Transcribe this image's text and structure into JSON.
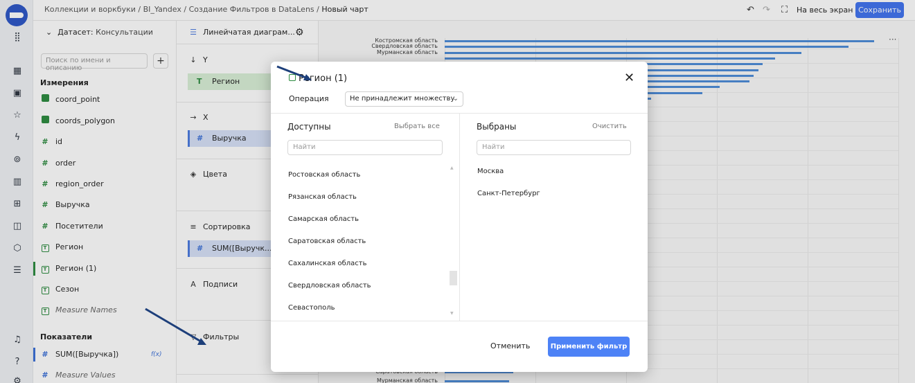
{
  "breadcrumbs": {
    "items": [
      "Коллекции и воркбуки",
      "BI_Yandex",
      "Создание Фильтров в DataLens"
    ],
    "sep": " / ",
    "current": "Новый чарт"
  },
  "header": {
    "fullscreen_label": "На весь экран",
    "save_label": "Сохранить"
  },
  "dataset": {
    "label": "Датасет:",
    "value": "Консультации",
    "search_placeholder": "Поиск по имени и описанию",
    "dimensions_title": "Измерения",
    "dimensions": [
      {
        "name": "coord_point",
        "type": "geo"
      },
      {
        "name": "coords_polygon",
        "type": "geo"
      },
      {
        "name": "id",
        "type": "num"
      },
      {
        "name": "order",
        "type": "num"
      },
      {
        "name": "region_order",
        "type": "num"
      },
      {
        "name": "Выручка",
        "type": "num"
      },
      {
        "name": "Посетители",
        "type": "num"
      },
      {
        "name": "Регион",
        "type": "text"
      },
      {
        "name": "Регион (1)",
        "type": "text"
      },
      {
        "name": "Сезон",
        "type": "text"
      },
      {
        "name": "Measure Names",
        "type": "text"
      }
    ],
    "measures_title": "Показатели",
    "measures": [
      {
        "name": "SUM([Выручка])",
        "badge": "f(x)"
      },
      {
        "name": "Measure Values"
      }
    ]
  },
  "shelves": {
    "chart_type": "Линейчатая диаграм...",
    "y_label": "Y",
    "y_chip": "Регион",
    "x_label": "X",
    "x_chip": "Выручка",
    "colors_label": "Цвета",
    "sort_label": "Сортировка",
    "sort_chip": "SUM([Выручк...",
    "labels_label": "Подписи",
    "filters_label": "Фильтры"
  },
  "chart_data": {
    "type": "bar",
    "categories": [
      "Костромская область",
      "Свердловская область",
      "Мурманская область",
      "",
      "",
      "",
      "",
      "",
      "",
      "",
      "",
      "",
      "Саратовская область",
      "Мурманская область"
    ],
    "values": [
      100,
      94,
      83,
      77,
      74,
      73,
      72,
      71,
      64,
      60,
      48,
      41,
      16,
      15
    ],
    "colors": {
      "bar": "#4b8ad8"
    }
  },
  "modal": {
    "title": "Регион (1)",
    "operation_label": "Операция",
    "operation_value": "Не принадлежит множеству",
    "available_title": "Доступны",
    "select_all_label": "Выбрать все",
    "selected_title": "Выбраны",
    "clear_label": "Очистить",
    "search_placeholder": "Найти",
    "available_items": [
      "Ростовская область",
      "Рязанская область",
      "Самарская область",
      "Саратовская область",
      "Сахалинская область",
      "Свердловская область",
      "Севастополь"
    ],
    "selected_items": [
      "Москва",
      "Санкт-Петербург"
    ],
    "cancel_label": "Отменить",
    "apply_label": "Применить фильтр"
  }
}
